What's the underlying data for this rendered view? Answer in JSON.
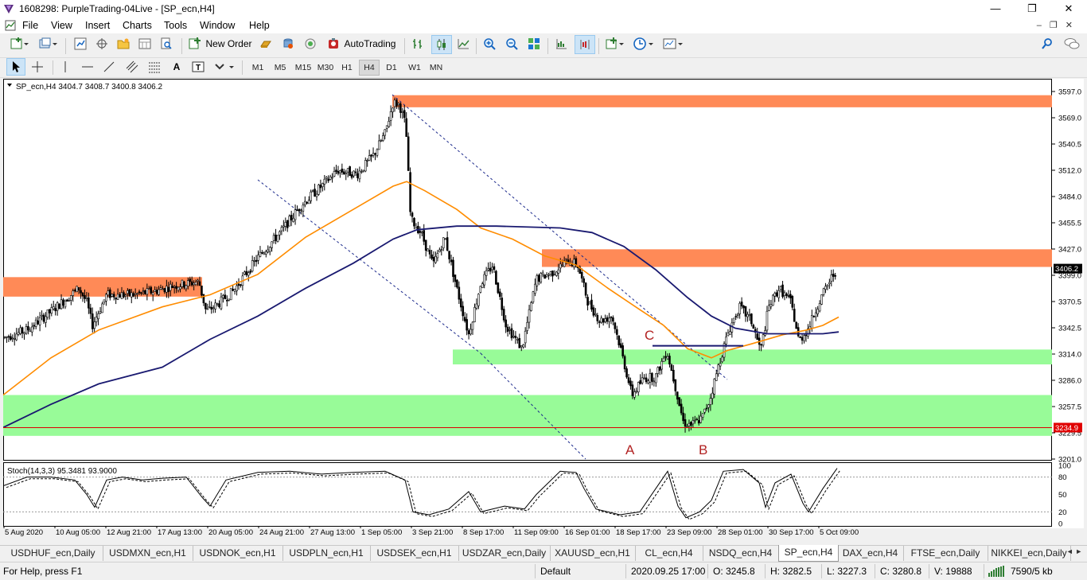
{
  "window": {
    "title": "1608298: PurpleTrading-04Live - [SP_ecn,H4]",
    "minimize": "—",
    "maximize": "❐",
    "close": "✕"
  },
  "menu": [
    "File",
    "View",
    "Insert",
    "Charts",
    "Tools",
    "Window",
    "Help"
  ],
  "toolbar": {
    "new_order": "New Order",
    "autotrading": "AutoTrading",
    "timeframes": [
      "M1",
      "M5",
      "M15",
      "M30",
      "H1",
      "H4",
      "D1",
      "W1",
      "MN"
    ],
    "active_timeframe": "H4"
  },
  "chart": {
    "info": "SP_ecn,H4  3404.7 3408.7 3400.8 3406.2",
    "price_ticks": [
      "3597.0",
      "3569.0",
      "3540.5",
      "3512.0",
      "3484.0",
      "3455.5",
      "3427.0",
      "3399.0",
      "3370.5",
      "3342.5",
      "3314.0",
      "3286.0",
      "3257.5",
      "3229.5",
      "3201.0"
    ],
    "current_price": "3406.2",
    "line_price": "3234.9",
    "date_ticks": [
      "5 Aug 2020",
      "10 Aug 05:00",
      "12 Aug 21:00",
      "17 Aug 13:00",
      "20 Aug 05:00",
      "24 Aug 21:00",
      "27 Aug 13:00",
      "1 Sep 05:00",
      "3 Sep 21:00",
      "8 Sep 17:00",
      "11 Sep 09:00",
      "16 Sep 01:00",
      "18 Sep 17:00",
      "23 Sep 09:00",
      "28 Sep 01:00",
      "30 Sep 17:00",
      "5 Oct 09:00"
    ],
    "annotations": [
      "A",
      "B",
      "C"
    ],
    "stoch_label": "Stoch(14,3,3) 95.3481 93.9000",
    "stoch_ticks": [
      "100",
      "80",
      "50",
      "20",
      "0"
    ],
    "colors": {
      "resistance_zone": "#ff8a57",
      "support_zone": "#98fb98",
      "ma_fast": "#ff8c00",
      "ma_slow": "#191970",
      "price_line": "#e00000",
      "candles": "#000000"
    }
  },
  "tabs": [
    "USDHUF_ecn,Daily",
    "USDMXN_ecn,H1",
    "USDNOK_ecn,H1",
    "USDPLN_ecn,H1",
    "USDSEK_ecn,H1",
    "USDZAR_ecn,Daily",
    "XAUUSD_ecn,H1",
    "CL_ecn,H4",
    "NSDQ_ecn,H4",
    "SP_ecn,H4",
    "DAX_ecn,H4",
    "FTSE_ecn,Daily",
    "NIKKEI_ecn,Daily"
  ],
  "active_tab": "SP_ecn,H4",
  "status": {
    "help": "For Help, press F1",
    "profile": "Default",
    "datetime": "2020.09.25 17:00",
    "open": "O: 3245.8",
    "high": "H: 3282.5",
    "low": "L: 3227.3",
    "close": "C: 3280.8",
    "volume": "V: 19888",
    "traffic": "7590/5 kb"
  }
}
